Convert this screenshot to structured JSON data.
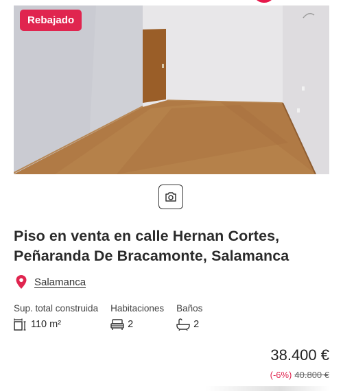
{
  "listing": {
    "badge": "Rebajado",
    "title": "Piso en venta en calle Hernan Cortes, Peñaranda De Bracamonte, Salamanca",
    "location": "Salamanca",
    "features": [
      {
        "label": "Sup. total construida",
        "value": "110 m²",
        "icon": "area-icon"
      },
      {
        "label": "Habitaciones",
        "value": "2",
        "icon": "bed-icon"
      },
      {
        "label": "Baños",
        "value": "2",
        "icon": "bathtub-icon"
      }
    ],
    "price": "38.400 €",
    "discount": "(-6%)",
    "old_price": "40.800 €"
  },
  "colors": {
    "accent": "#e0254f"
  }
}
